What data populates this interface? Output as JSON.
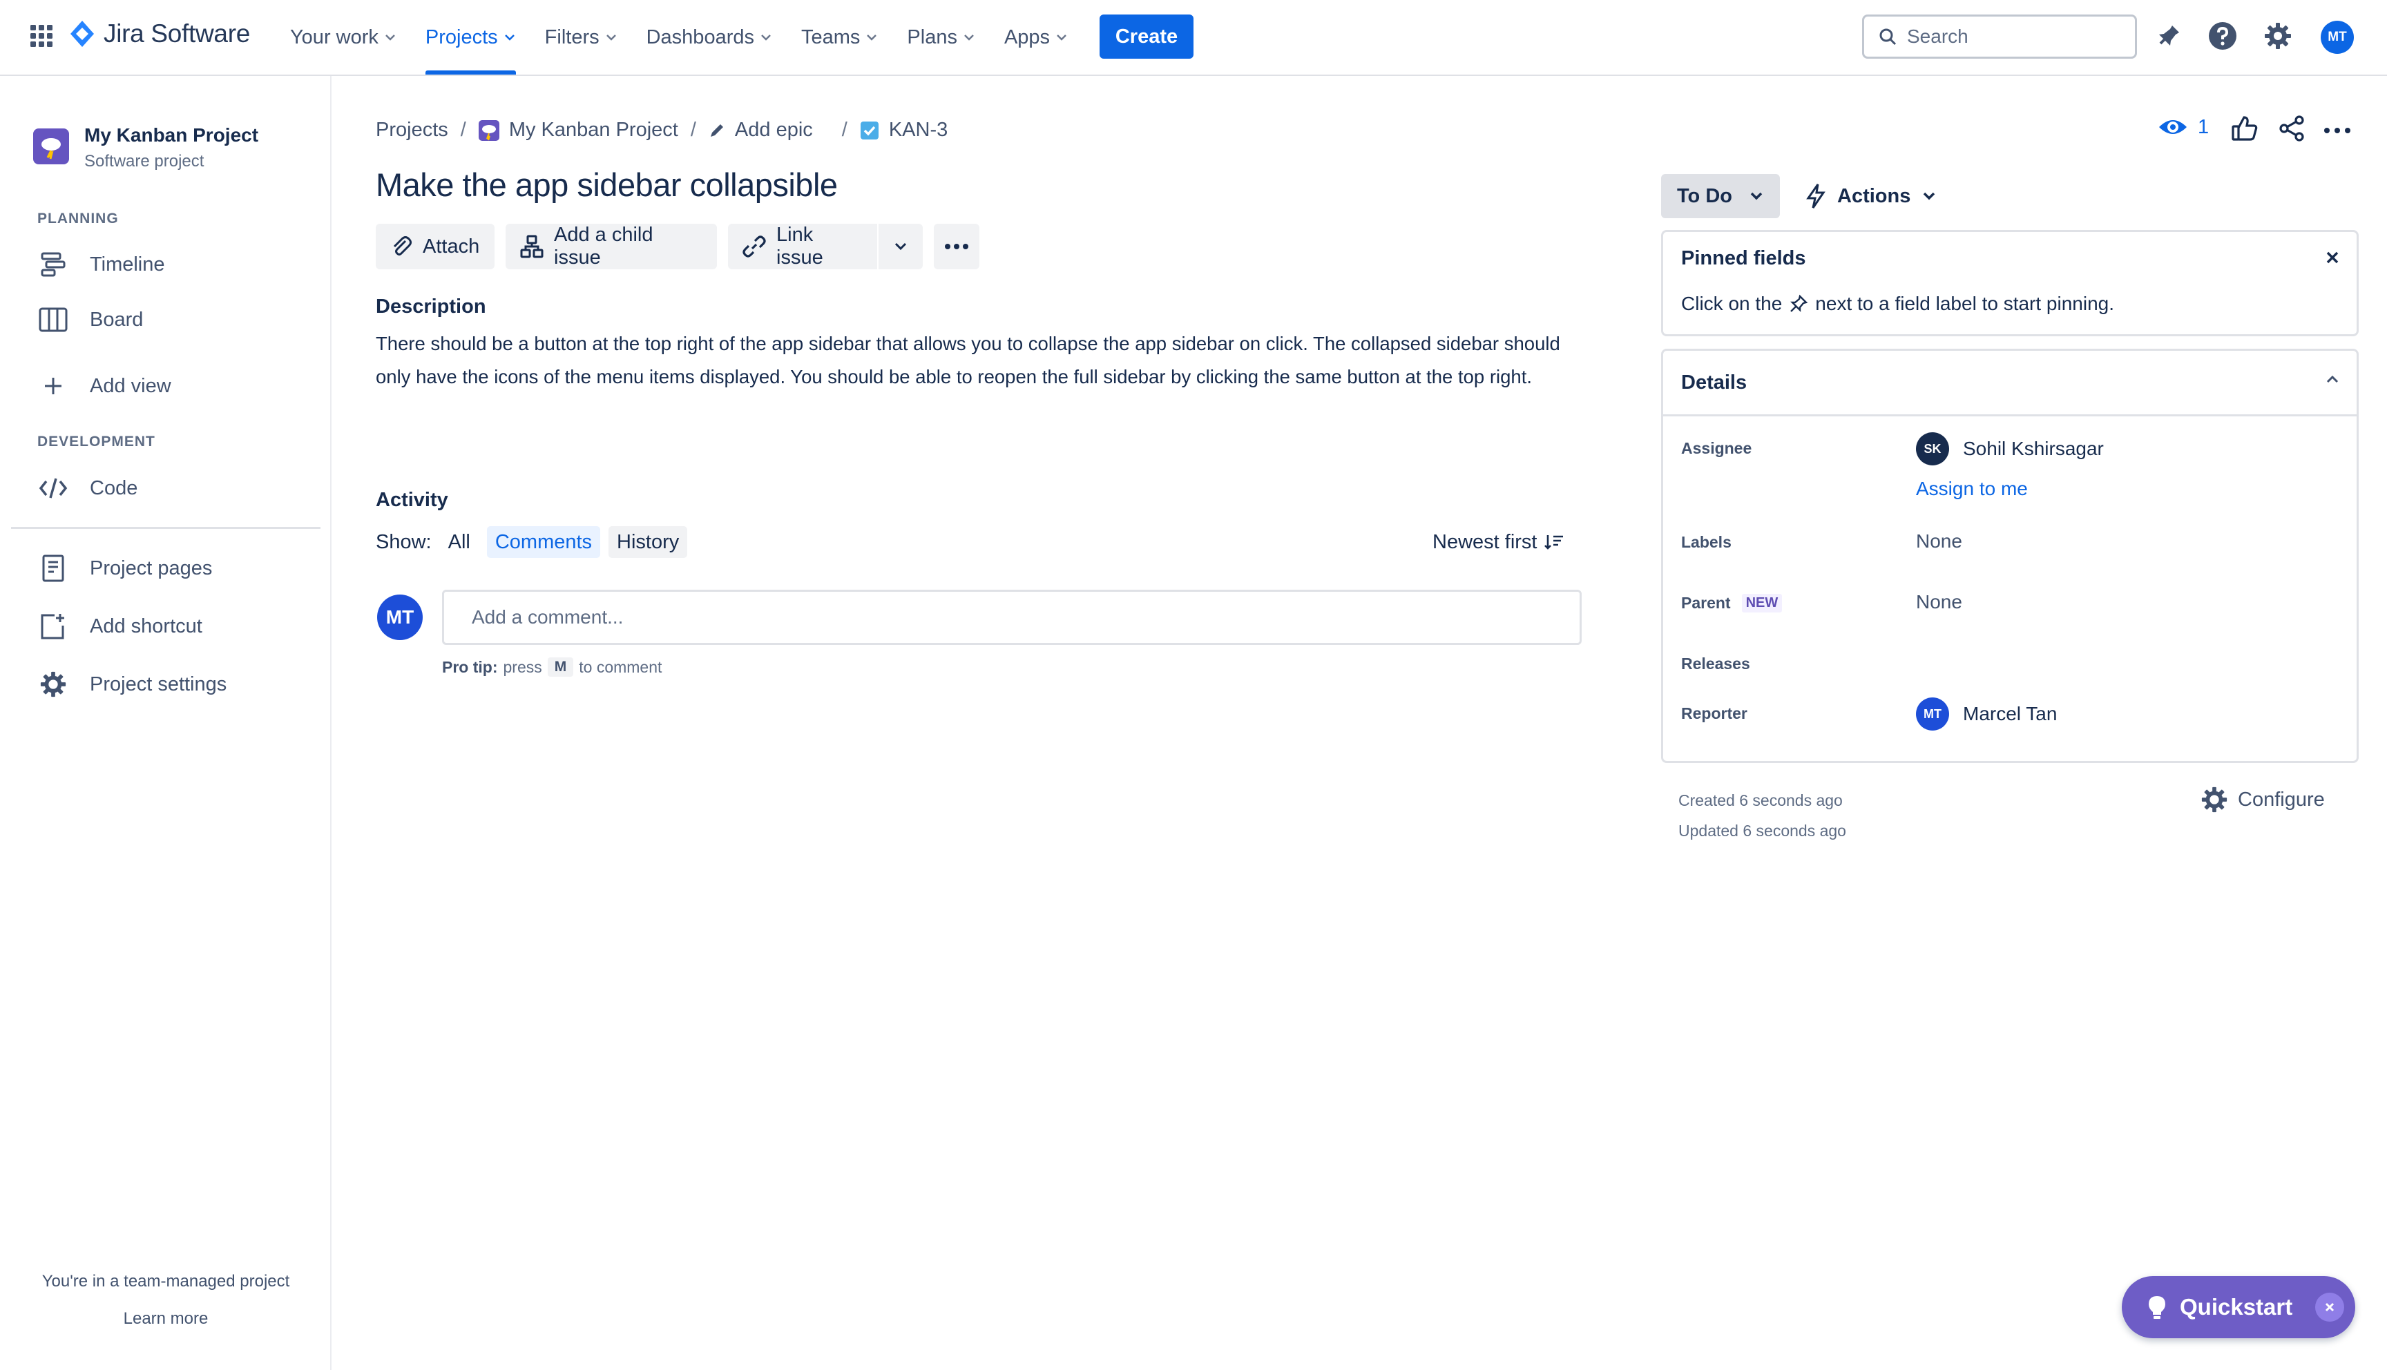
{
  "app": {
    "name": "Jira Software",
    "brand_color": "#0c66e4"
  },
  "topnav": {
    "items": [
      {
        "label": "Your work"
      },
      {
        "label": "Projects",
        "active": true
      },
      {
        "label": "Filters"
      },
      {
        "label": "Dashboards"
      },
      {
        "label": "Teams"
      },
      {
        "label": "Plans"
      },
      {
        "label": "Apps"
      }
    ],
    "create_label": "Create",
    "search_placeholder": "Search",
    "user_initials": "MT"
  },
  "sidebar": {
    "project_name": "My Kanban Project",
    "project_type": "Software project",
    "planning_heading": "PLANNING",
    "planning_items": [
      {
        "label": "Timeline",
        "icon": "timeline-icon"
      },
      {
        "label": "Board",
        "icon": "board-icon"
      }
    ],
    "add_view_label": "Add view",
    "development_heading": "DEVELOPMENT",
    "development_items": [
      {
        "label": "Code",
        "icon": "code-icon"
      }
    ],
    "bottom_items": [
      {
        "label": "Project pages",
        "icon": "page-icon"
      },
      {
        "label": "Add shortcut",
        "icon": "add-shortcut-icon"
      },
      {
        "label": "Project settings",
        "icon": "gear-icon"
      }
    ],
    "footer_text": "You're in a team-managed project",
    "footer_link": "Learn more"
  },
  "issue": {
    "breadcrumb": {
      "projects": "Projects",
      "project": "My Kanban Project",
      "epic": "Add epic",
      "key": "KAN-3"
    },
    "title": "Make the app sidebar collapsible",
    "toolbar": {
      "attach": "Attach",
      "child": "Add a child issue",
      "link": "Link issue"
    },
    "description_heading": "Description",
    "description": "There should be a button at the top right of the app sidebar that allows you to collapse the app sidebar on click. The collapsed sidebar should only have the icons of the menu items displayed. You should be able to reopen the full sidebar by clicking the same button at the top right.",
    "activity": {
      "heading": "Activity",
      "show_label": "Show:",
      "filters": [
        "All",
        "Comments",
        "History"
      ],
      "selected_filter": "Comments",
      "sort_label": "Newest first",
      "comment_placeholder": "Add a comment...",
      "user_initials": "MT",
      "tip_prefix": "Pro tip:",
      "tip_press": "press",
      "tip_key": "M",
      "tip_suffix": "to comment"
    }
  },
  "right": {
    "watch_count": "1",
    "status": "To Do",
    "actions_label": "Actions",
    "pinned": {
      "heading": "Pinned fields",
      "text_before": "Click on the",
      "text_after": "next to a field label to start pinning."
    },
    "details": {
      "heading": "Details",
      "assignee_label": "Assignee",
      "assignee_initials": "SK",
      "assignee_name": "Sohil Kshirsagar",
      "assign_to_me": "Assign to me",
      "labels_label": "Labels",
      "labels_value": "None",
      "parent_label": "Parent",
      "parent_badge": "NEW",
      "parent_value": "None",
      "releases_label": "Releases",
      "reporter_label": "Reporter",
      "reporter_initials": "MT",
      "reporter_name": "Marcel Tan"
    },
    "created": "Created 6 seconds ago",
    "updated": "Updated 6 seconds ago",
    "configure_label": "Configure"
  },
  "quickstart": {
    "label": "Quickstart"
  }
}
